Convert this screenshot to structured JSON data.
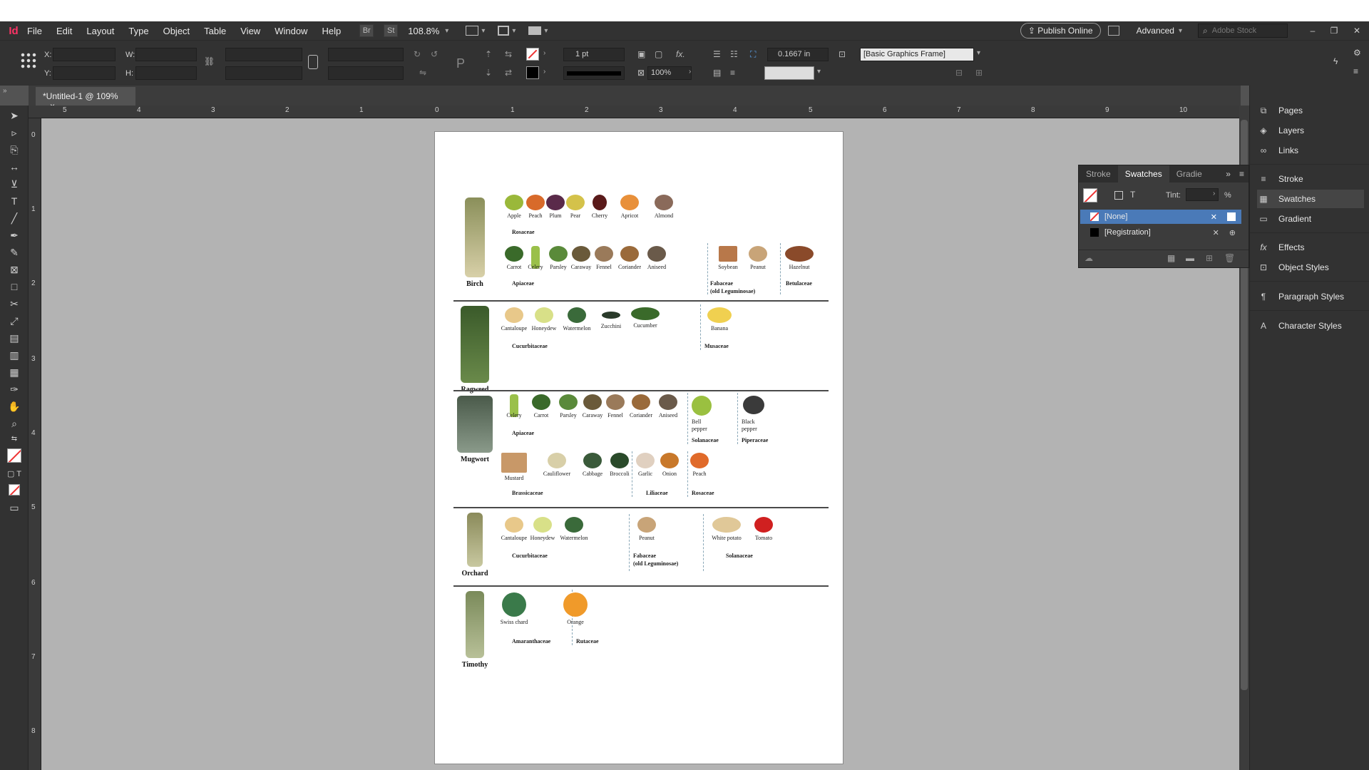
{
  "app": {
    "logo": "Id"
  },
  "menu": [
    "File",
    "Edit",
    "Layout",
    "Type",
    "Object",
    "Table",
    "View",
    "Window",
    "Help"
  ],
  "menubar": {
    "br": "Br",
    "st": "St",
    "zoom": "108.8%",
    "publish": "Publish Online",
    "workspace": "Advanced",
    "stock_placeholder": "Adobe Stock"
  },
  "control": {
    "x_label": "X:",
    "y_label": "Y:",
    "w_label": "W:",
    "h_label": "H:",
    "stroke_weight": "1 pt",
    "scale": "100%",
    "offset": "0.1667 in",
    "object_style": "[Basic Graphics Frame]"
  },
  "tab": {
    "title": "*Untitled-1 @ 109%",
    "close": "×"
  },
  "ruler_h": [
    "5",
    "4",
    "3",
    "2",
    "1",
    "0",
    "1",
    "2",
    "3",
    "4",
    "5",
    "6",
    "7",
    "8",
    "9",
    "10"
  ],
  "ruler_v": [
    "0",
    "1",
    "2",
    "3",
    "4",
    "5",
    "6",
    "7",
    "8"
  ],
  "panels": {
    "items": [
      "Pages",
      "Layers",
      "Links",
      "Stroke",
      "Swatches",
      "Gradient",
      "Effects",
      "Object Styles",
      "Paragraph Styles",
      "Character Styles"
    ],
    "icons": [
      "pages-icon",
      "layers-icon",
      "links-icon",
      "stroke-icon",
      "swatches-icon",
      "gradient-icon",
      "effects-icon",
      "object-styles-icon",
      "paragraph-styles-icon",
      "character-styles-icon"
    ]
  },
  "swatches_panel": {
    "tabs": [
      "Stroke",
      "Swatches",
      "Gradie"
    ],
    "tint_label": "Tint:",
    "percent": "%",
    "t_label": "T",
    "rows": [
      "[None]",
      "[Registration]"
    ]
  },
  "document": {
    "plants": [
      "Birch",
      "Ragweed",
      "Mugwort",
      "Orchard",
      "Timothy"
    ],
    "birch_row1": [
      "Apple",
      "Peach",
      "Plum",
      "Pear",
      "Cherry",
      "Apricot",
      "Almond"
    ],
    "birch_row1_family": "Rosaceae",
    "birch_row2": [
      "Carrot",
      "Celery",
      "Parsley",
      "Caraway",
      "Fennel",
      "Coriander",
      "Aniseed",
      "Soybean",
      "Peanut",
      "Hazelnut"
    ],
    "birch_fam_apiaceae": "Apiaceae",
    "birch_fam_fabaceae": "Fabaceae",
    "birch_fam_fabaceae_old": "(old Leguminosae)",
    "birch_fam_betulaceae": "Betulaceae",
    "ragweed_items": [
      "Cantaloupe",
      "Honeydew",
      "Watermelon",
      "Zucchini",
      "Cucumber",
      "Banana"
    ],
    "ragweed_fam_cucurbitaceae": "Cucurbitaceae",
    "ragweed_fam_musaceae": "Musaceae",
    "mugwort_row1": [
      "Celery",
      "Carrot",
      "Parsley",
      "Caraway",
      "Fennel",
      "Coriander",
      "Aniseed",
      "Bell",
      "pepper",
      "Black",
      "pepper"
    ],
    "mugwort_fam_apiaceae": "Apiaceae",
    "mugwort_fam_solanaceae": "Solanaceae",
    "mugwort_fam_piperaceae": "Piperaceae",
    "mugwort_row2": [
      "Mustard",
      "Cauliflower",
      "Cabbage",
      "Broccoli",
      "Garlic",
      "Onion",
      "Peach"
    ],
    "mugwort_fam_brassicaceae": "Brassicaceae",
    "mugwort_fam_liliaceae": "Liliaceae",
    "mugwort_fam_rosaceae": "Rosaceae",
    "orchard_items": [
      "Cantaloupe",
      "Honeydew",
      "Watermelon",
      "Peanut",
      "White potato",
      "Tomato"
    ],
    "orchard_fam_cucurbitaceae": "Cucurbitaceae",
    "orchard_fam_fabaceae": "Fabaceae",
    "orchard_fam_fabaceae_old": "(old Leguminosae)",
    "orchard_fam_solanaceae": "Solanaceae",
    "timothy_items": [
      "Swiss chard",
      "Orange"
    ],
    "timothy_fam_amaranthaceae": "Amaranthaceae",
    "timothy_fam_rutaceae": "Rutaceae"
  },
  "colors": {
    "accent": "#ff3366",
    "panel": "#323232",
    "pasteboard": "#b3b3b3",
    "page": "#ffffff",
    "selection": "#4a7ab8"
  }
}
